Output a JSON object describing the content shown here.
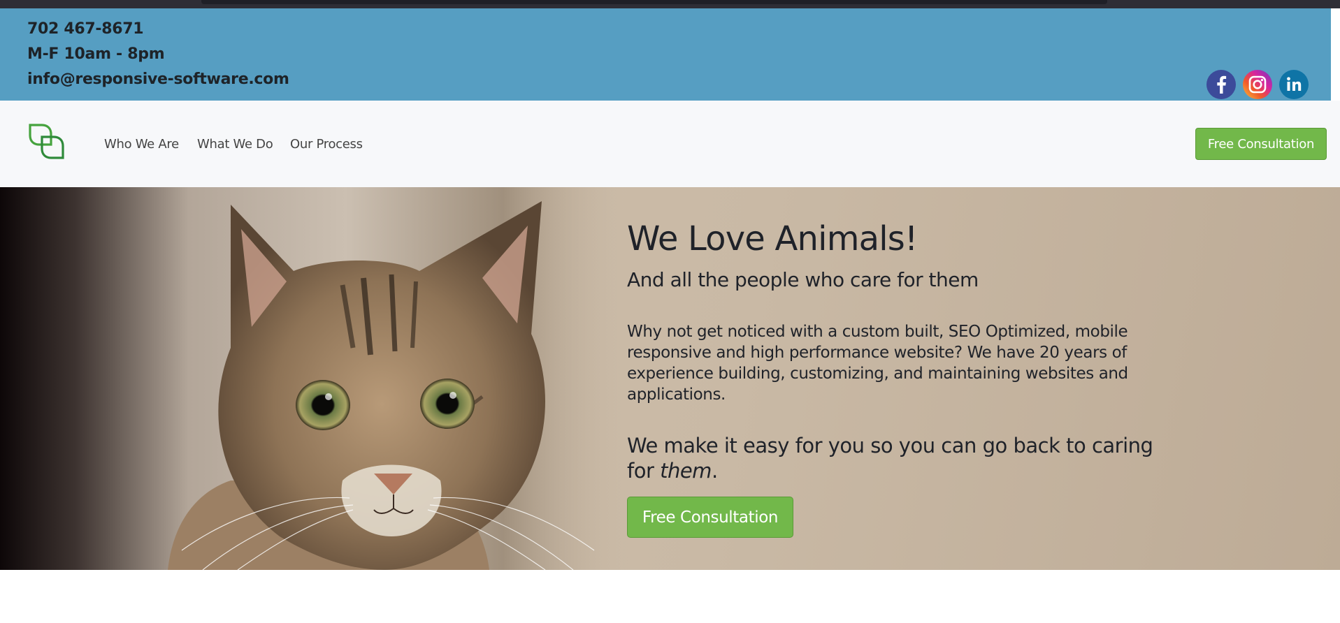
{
  "contact": {
    "phone": "702 467-8671",
    "hours": "M-F 10am - 8pm",
    "email": "info@responsive-software.com"
  },
  "social": [
    {
      "icon": "facebook-icon",
      "color": "#3b5998"
    },
    {
      "icon": "instagram-icon",
      "color": "#d6249f"
    },
    {
      "icon": "linkedin-icon",
      "color": "#0e76a8"
    }
  ],
  "nav": {
    "links": [
      "Who We Are",
      "What We Do",
      "Our Process"
    ],
    "cta_label": "Free Consultation"
  },
  "hero": {
    "title": "We Love Animals!",
    "subtitle": "And all the people who care for them",
    "paragraph": "Why not get noticed with a custom built, SEO Optimized, mobile responsive and high performance website? We have 20 years of experience building, customizing, and maintaining websites and applications.",
    "tagline_prefix": "We make it easy for you so you can go back to caring for ",
    "tagline_emphasis": "them",
    "tagline_suffix": ".",
    "cta_label": "Free Consultation"
  },
  "colors": {
    "contact_bar": "#569ec2",
    "nav_bg": "#f7f8fa",
    "accent_green": "#72b84a",
    "hero_bg": "#cfc0ad"
  }
}
